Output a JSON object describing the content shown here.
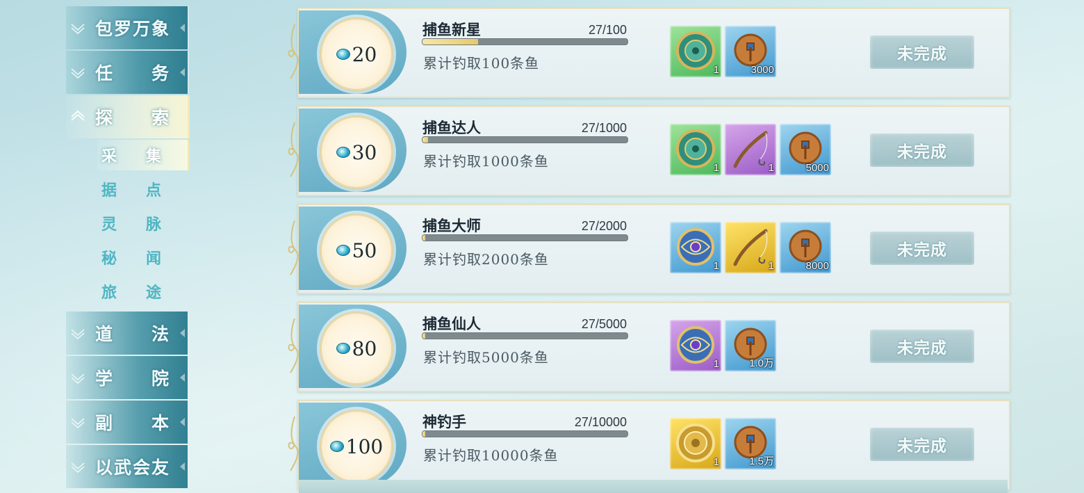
{
  "sidebar": {
    "main": [
      {
        "label": "包罗万象",
        "active": false
      },
      {
        "label": "任务",
        "active": false
      },
      {
        "label": "探索",
        "active": true
      },
      {
        "label": "道法",
        "active": false
      },
      {
        "label": "学院",
        "active": false
      },
      {
        "label": "副本",
        "active": false
      },
      {
        "label": "以武会友",
        "active": false
      }
    ],
    "sub": [
      {
        "label": "采集",
        "active": true
      },
      {
        "label": "据点",
        "active": false
      },
      {
        "label": "灵脉",
        "active": false
      },
      {
        "label": "秘闻",
        "active": false
      },
      {
        "label": "旅途",
        "active": false
      }
    ]
  },
  "achievements": [
    {
      "points": "20",
      "title": "捕鱼新星",
      "count": "27/100",
      "progress": 0.27,
      "desc": "累计钓取100条鱼",
      "rewards": [
        {
          "type": "green",
          "icon": "jade-disc-icon",
          "qty": "1"
        },
        {
          "type": "blue",
          "icon": "copper-coin-icon",
          "qty": "3000"
        }
      ],
      "status": "未完成"
    },
    {
      "points": "30",
      "title": "捕鱼达人",
      "count": "27/1000",
      "progress": 0.027,
      "desc": "累计钓取1000条鱼",
      "rewards": [
        {
          "type": "green",
          "icon": "jade-disc-icon",
          "qty": "1"
        },
        {
          "type": "purple",
          "icon": "fishing-rod-icon",
          "qty": "1"
        },
        {
          "type": "blue",
          "icon": "copper-coin-icon",
          "qty": "5000"
        }
      ],
      "status": "未完成"
    },
    {
      "points": "50",
      "title": "捕鱼大师",
      "count": "27/2000",
      "progress": 0.0135,
      "desc": "累计钓取2000条鱼",
      "rewards": [
        {
          "type": "blue",
          "icon": "gem-disc-icon",
          "qty": "1"
        },
        {
          "type": "gold",
          "icon": "fishing-rod-icon",
          "qty": "1"
        },
        {
          "type": "blue",
          "icon": "copper-coin-icon",
          "qty": "8000"
        }
      ],
      "status": "未完成"
    },
    {
      "points": "80",
      "title": "捕鱼仙人",
      "count": "27/5000",
      "progress": 0.0054,
      "desc": "累计钓取5000条鱼",
      "rewards": [
        {
          "type": "purple",
          "icon": "gem-disc-icon",
          "qty": "1"
        },
        {
          "type": "blue",
          "icon": "copper-coin-icon",
          "qty": "1.0万"
        }
      ],
      "status": "未完成"
    },
    {
      "points": "100",
      "title": "神钓手",
      "count": "27/10000",
      "progress": 0.0027,
      "desc": "累计钓取10000条鱼",
      "rewards": [
        {
          "type": "gold",
          "icon": "gold-disc-icon",
          "qty": "1"
        },
        {
          "type": "blue",
          "icon": "copper-coin-icon",
          "qty": "1.5万"
        }
      ],
      "status": "未完成"
    }
  ],
  "colors": {
    "accent": "#4fb6c3",
    "progress_fill": "#e8c969",
    "button": "#a9c7cc"
  }
}
